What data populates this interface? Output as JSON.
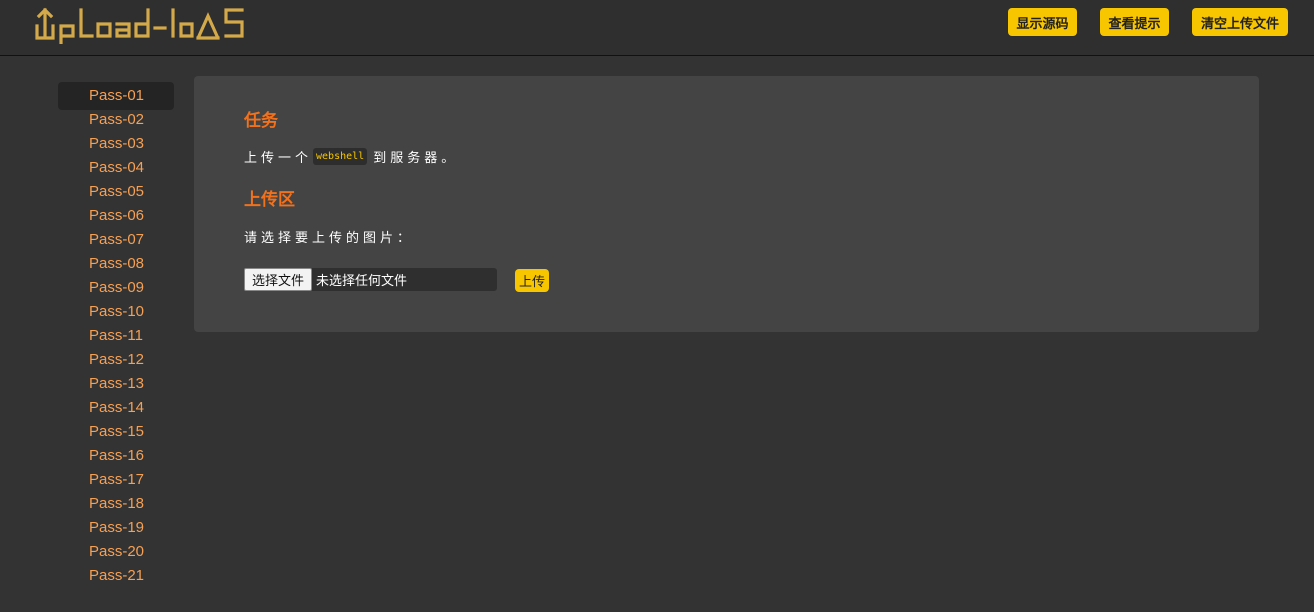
{
  "header": {
    "logo_text": "Upload-labs",
    "buttons": {
      "show_source": "显示源码",
      "view_hint": "查看提示",
      "clear_uploads": "清空上传文件"
    }
  },
  "sidebar": {
    "active": "Pass-01",
    "items": [
      {
        "label": "Pass-01"
      },
      {
        "label": "Pass-02"
      },
      {
        "label": "Pass-03"
      },
      {
        "label": "Pass-04"
      },
      {
        "label": "Pass-05"
      },
      {
        "label": "Pass-06"
      },
      {
        "label": "Pass-07"
      },
      {
        "label": "Pass-08"
      },
      {
        "label": "Pass-09"
      },
      {
        "label": "Pass-10"
      },
      {
        "label": "Pass-11"
      },
      {
        "label": "Pass-12"
      },
      {
        "label": "Pass-13"
      },
      {
        "label": "Pass-14"
      },
      {
        "label": "Pass-15"
      },
      {
        "label": "Pass-16"
      },
      {
        "label": "Pass-17"
      },
      {
        "label": "Pass-18"
      },
      {
        "label": "Pass-19"
      },
      {
        "label": "Pass-20"
      },
      {
        "label": "Pass-21"
      }
    ]
  },
  "main": {
    "task_title": "任务",
    "task_text_before": "上传一个",
    "task_code": "webshell",
    "task_text_after": "到服务器。",
    "upload_title": "上传区",
    "select_prompt": "请选择要上传的图片：",
    "file_input": {
      "button_label": "选择文件",
      "status": "未选择任何文件"
    },
    "upload_button": "上传"
  },
  "colors": {
    "background": "#333333",
    "panel": "#444444",
    "accent_yellow": "#f7c600",
    "heading_orange": "#f2711c",
    "link_orange": "#f5a054"
  }
}
